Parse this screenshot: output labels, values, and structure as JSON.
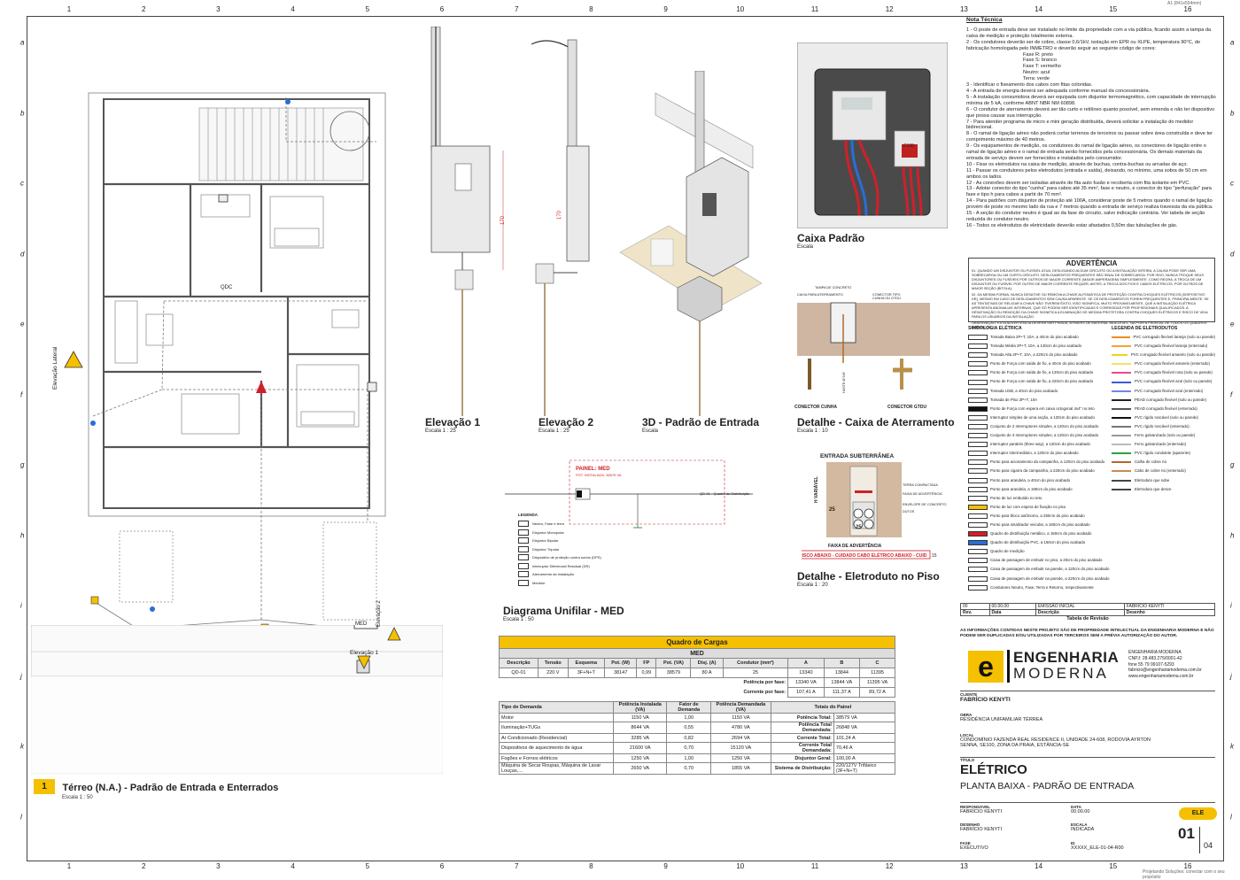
{
  "sheet": {
    "top_code": "A1 (841x594mm)",
    "bottom_note": "Projetando Soluções: conectar com o seu propósito",
    "ruler_numbers": [
      "1",
      "2",
      "3",
      "4",
      "5",
      "6",
      "7",
      "8",
      "9",
      "10",
      "11",
      "12",
      "13",
      "14",
      "15",
      "16"
    ],
    "ruler_letters": [
      "a",
      "b",
      "c",
      "d",
      "e",
      "f",
      "g",
      "h",
      "i",
      "j",
      "k",
      "l"
    ]
  },
  "plan": {
    "number": "1",
    "title": "Térreo (N.A.) - Padrão de Entrada e Enterrados",
    "scale": "Escala  1 : 50",
    "elev_lateral": "Elevação Lateral",
    "elev1": "Elevação 1",
    "elev2": "Elevação 2",
    "med_label": "MED",
    "qdc_label": "QDC"
  },
  "views": {
    "elev1_title": "Elevação 1",
    "elev1_scale": "Escala  1 : 25",
    "elev2_title": "Elevação 2",
    "elev2_scale": "Escala  1 : 25",
    "view3d_title": "3D - Padrão de Entrada",
    "view3d_scale": "Escala",
    "caixa_title": "Caixa Padrão",
    "caixa_scale": "Escala",
    "aterr_title": "Detalhe - Caixa de Aterramento",
    "aterr_scale": "Escala  1 : 10",
    "eletroduto_title": "Detalhe - Eletroduto no Piso",
    "eletroduto_scale": "Escala  1 : 20",
    "unifilar_title": "Diagrama Unifilar - MED",
    "unifilar_scale": "Escala  1 : 50",
    "dim_170": "170",
    "entrada_subterranea": "ENTRADA SUBTERRÂNEA",
    "faixa_adv": "FAIXA DE ADVERTÊNCIA",
    "faixa_text": "RISCO ABAIXO - CUIDADO CABO ELÉTRICO ABAIXO - CUID",
    "conector_cunha": "CONECTOR CUNHA",
    "conector_gtdu": "CONECTOR GTDU",
    "tampa": "TAMPA DE CONCRETO",
    "caixa_aterr": "CAIXA PARA ATERRAMENTO",
    "conector_tipo": "CONECTOR TIPO CUNHA OU GTDU",
    "haste": "HASTE Ø 5/8\"",
    "painel_med": "PAINEL: MED",
    "pot_instalada": "POT. INSTALADA: 38579 VA",
    "qd01": "QD-01 - Quadro de Distribuição",
    "legenda": "LEGENDA",
    "leg_items": [
      "Neutro, Fase e terra",
      "Disjuntor Monopolar",
      "Disjuntor Bipolar",
      "Disjuntor Tripolar",
      "Dispositivo de proteção contra surtos (DPS)",
      "Interruptor Diferencial Residual (DR)",
      "Aterramento da Instalação",
      "Medidor"
    ],
    "terra_compactada": "TERRA COMPACTADA",
    "faixa_adv2": "FAIXA DE ADVERTÊNCIA",
    "envelope": "ENVELOPE DE CONCRETO",
    "dutos": "DUTOS",
    "dim_25": "25",
    "dim_var": "H VARIÁVEL",
    "dim_15": "15",
    "meter_label": "C100"
  },
  "notes": {
    "heading": "Nota Técnica",
    "lines": [
      "1 - O poste de entrada deve ser instalado no limite da propriedade com a via pública, ficando assim a tampa da caixa de medição e proteção totalmente externa.",
      "2 - Os condutores deverão ser de cobre, classe  0,6/1kV, isolação em EPR ou XLPE, temperatura 90°C, de fabricação homologada pelo INMETRO e deverão seguir ao seguinte código de cores:",
      "Fase R: preto",
      "Fase S: branco",
      "Fase T: vermelho",
      "Neutro: azul",
      "Terra: verde",
      "3 - Identificar o fiseamento dos cabos com fitas coloridas.",
      "4 - A entrada de energia deverá ser adequada conforme manual da concessionária.",
      "5 - A instalação consumidora deverá ser equipada com disjuntor termomagnético, com capacidade de interrupção mínima de 5 kA, conforme ABNT NBR NM 60898.",
      "6 - O condutor de aterramento deverá ser tão curto e retilíneo quanto possível, sem emenda e não ter dispositivo que possa causar sua interrupção.",
      "7 - Para atender programa de micro e mini geração distribuída, deverá solicitar a instalação do medidor bidirecional.",
      "8 - O ramal de ligação aéreo não poderá cortar terrenos de terceiros ou passar sobre área construída e deve ter comprimento máximo de 40 metros.",
      "9 - Os equipamentos de medição, os condutores do ramal de ligação aéreo, os conectores de ligação entre o ramal de ligação aéreo e o ramal de entrada serão fornecidos pela concessionária. Os demais materiais da entrada de serviço devem ser fornecidos e instalados pelo consumidor.",
      "10 - Fixar os eletrodutos na caixa de medição, através de buchas, contra-buchas ou arruelas de aço.",
      "11 - Passar os condutores pelos eletrodutos (entrada e saída), deixando, no mínimo, uma sobra de 50 cm em ambos os lados.",
      "12 - As conexões devem ser isoladas através de fita auto fusão e recoberta com fita isolante em PVC.",
      "13 - Adotar conector do tipo \"cunha\" para cabos até 35 mm², fase e neutro, e conector do tipo \"perfuração\" para fase e tipo h para cabos a partir de 70 mm².",
      "14 - Para padrões com disjuntor de proteção até 100A, considerar poste de 5 metros quando o ramal de ligação provém de poste no mesmo lado da rua e 7 metros quando a entrada de serviço realiza travessia da via pública.",
      "15 - A seção do condutor neutro é igual ao da fase do circuito, salvo indicação contrária. Ver tabela de seção reduzida do condutor neutro.",
      "16 - Todos os eletrodutos de eletricidade deverão estar afastados 0,50m das tubulações de gás."
    ]
  },
  "advert": {
    "heading": "ADVERTÊNCIA",
    "p1": "01. QUANDO UM DISJUNTOR OU FUSÍVEL ATUA, DESLIGANDO ALGUM CIRCUITO OU A INSTALAÇÃO INTEIRA, A CAUSA PODE SER UMA SOBRECARGA OU UM CURTO-CIRCUITO. DESLIGAMENTOS FREQUENTES SÃO SINAL DE SOBRECARGA. POR ISSO, NUNCA TROQUE SEUS DISJUNTORES OU FUSÍVEIS POR OUTROS DE MAIOR CORRENTE (MAIOR AMPERAGEM) SIMPLESMENTE. COMO REGRA, A TROCA DE UM DISJUNTOR OU FUSÍVEL POR OUTRO DE MAIOR CORRENTE REQUER, ANTES, A TROCA DOS FIOS E CABOS ELÉTRICOS, POR OUTROS DE MAIOR SEÇÃO (BITOLA).",
    "p2": "02. DA MESMA FORMA, NUNCA DESATIVE OU REMOVA A CHAVE AUTOMÁTICA DE PROTEÇÃO CONTRA CHOQUES ELÉTRICOS (DISPOSITIVO DR), MESMO EM CASO DE DESLIGAMENTOS SEM CAUSA APARENTE. SE OS DESLIGAMENTOS FOREM FREQUENTES E, PRINCIPALMENTE, SE AS TENTATIVAS DE RELIGAR A CHAVE NÃO TIVEREM ÊXITO, ISSO SIGNIFICA, MUITO PROVAVELMENTE, QUE A INSTALAÇÃO ELÉTRICA APRESENTA ANOMALIAS INTERNAS, QUE SÓ PODEM SER IDENTIFICADAS E CORRIGIDAS POR PROFISSIONAIS QUALIFICADOS. A DESATIVAÇÃO OU REMOÇÃO DA CHAVE SIGNIFICA A ELIMINAÇÃO DE MEDIDA PROTETORA CONTRA CHOQUES ELÉTRICOS E RISCO DE VIDA PARA OS USUÁRIOS DA INSTALAÇÃO.",
    "obs": "OBSERVAÇÃO: ESTA ADVERTÊNCIA DEVERÁ SER FIXADA, ATRAVÉS DE MATERIAL INDELÉVEL, NA PORTA FRONTAL DE TODOS OS QUADROS ELÉTRICOS."
  },
  "legend": {
    "simb_heading": "SIMBOLOGIA ELÉTRICA",
    "eletr_heading": "LEGENDA DE ELETRODUTOS",
    "simb": [
      "Tomada Baixa 2P+T, 10A, a 40cm do piso acabado",
      "Tomada Média 2P+T, 10A, a 130cm do piso acabado",
      "Tomada Alta 2P+T, 10A, a 220cm do piso acabado",
      "Ponto de Força com saída de fio, a 40cm do piso acabado",
      "Ponto de Força com saída de fio, a 120cm do piso acabado",
      "Ponto de Força com saída de fio, a 220cm do piso acabado",
      "Tomada USB, a 40cm do piso acabado",
      "Tomada de Piso 2P+T, 10A",
      "Ponto de Força com espera em caixa octogonal 4x4\" no teto",
      "Interruptor simples de uma seção, a 120cm do piso acabado",
      "Conjunto de 2 Interruptores simples, a 120cm do piso acabado",
      "Conjunto de 3 Interruptores simples, a 120cm do piso acabado",
      "Interruptor paralelo (three way), a 120cm do piso acabado",
      "Interruptor intermediário, a 120cm do piso acabado",
      "Ponto para acionamento da campainha, a 120cm do piso acabado",
      "Ponto para cigarra da campainha, a 220cm do piso acabado",
      "Ponto para arandela, a 40cm do piso acabado",
      "Ponto para arandela, a 180cm do piso acabado",
      "Ponto de luz embutido no teto",
      "Ponto de luz com espera de fixação no piso",
      "Ponto para bloco autônomo, a 250cm do piso acabado",
      "Ponto para sinalizador veicular, a 160cm do piso acabado",
      "Quadro de distribuição metálico, a 150cm do piso acabado",
      "Quadro de distribuição PVC, a 150cm do piso acabado",
      "Quadro de medição",
      "Caixa de passagem de embutir no piso, a 40cm do piso acabado",
      "Caixa de passagem de embutir na parede, a 120cm do piso acabado",
      "Caixa de passagem de embutir na parede, a 220cm do piso acabado",
      "Condutores Neutro, Fase, Terra e Retorno, respectivamente"
    ],
    "eletr": [
      {
        "label": "PVC corrugado flexível laranja (solo ou parede)",
        "color": "#f08a1c"
      },
      {
        "label": "PVC corrugado flexível laranja (enterrado)",
        "color": "#f5a33a"
      },
      {
        "label": "PVC corrugado flexível amarelo (solo ou parede)",
        "color": "#f2d21c"
      },
      {
        "label": "PVC corrugado flexível amarelo (enterrado)",
        "color": "#f6e06a"
      },
      {
        "label": "PVC corrugado flexível rosa (solo ou parede)",
        "color": "#e94b8a"
      },
      {
        "label": "PVC corrugado flexível azul (solo ou parede)",
        "color": "#3a5ad8"
      },
      {
        "label": "PVC corrugado flexível azul (enterrado)",
        "color": "#6f88e6"
      },
      {
        "label": "PEAD corrugado flexível (solo ou parede)",
        "color": "#222222"
      },
      {
        "label": "PEAD corrugado flexível (enterrado)",
        "color": "#555555"
      },
      {
        "label": "PVC rígido roscável (solo ou parede)",
        "color": "#111111"
      },
      {
        "label": "PVC rígido roscável (enterrado)",
        "color": "#777777"
      },
      {
        "label": "Ferro galvanizado (solo ou parede)",
        "color": "#999999"
      },
      {
        "label": "Ferro galvanizado (enterrado)",
        "color": "#bbbbbb"
      },
      {
        "label": "PVC rígido condulete (aparente)",
        "color": "#2f9e44"
      },
      {
        "label": "Calha de cobre nú",
        "color": "#b06a2e"
      },
      {
        "label": "Cabo de cobre nú (enterrado)",
        "color": "#c98a50"
      },
      {
        "label": "Eletroduto que sobe",
        "color": "#444444"
      },
      {
        "label": "Eletroduto que desce",
        "color": "#444444"
      }
    ]
  },
  "revision": {
    "row": [
      "00",
      "00.00.00",
      "EMISSÃO INICIAL",
      "FABRÍCIO KENYTI"
    ],
    "head": [
      "Rev.",
      "Data",
      "Descrição",
      "Desenho"
    ],
    "title": "Tabela de Revisão"
  },
  "titleblock": {
    "disclaimer": "AS INFORMAÇÕES CONTIDAS NESTE PROJETO SÃO DE PROPRIEDADE INTELECTUAL DA ENGENHARIA MODERNA E NÃO PODEM SER DUPLICADAS E/OU UTILIZADAS POR TERCEIROS SEM A PRÉVIA AUTORIZAÇÃO DO AUTOR.",
    "logo_line1": "ENGENHARIA",
    "logo_line2": "MODERNA",
    "company": "ENGENHARIA MODERNA",
    "cnpj": "CNPJ: 28.483.275/0001-42",
    "fone": "fone 55 79 99107-5293",
    "email": "fabricio@engenhariamoderna.com.br",
    "site": "www.engenhariamoderna.com.br",
    "cliente_label": "CLIENTE",
    "cliente": "FABRÍCIO KENYTI",
    "obra_label": "OBRA",
    "obra": "RESIDÊNCIA UNIFAMILIAR TÉRREA",
    "local_label": "LOCAL",
    "local": "CONDOMÍNIO FAZENDA REAL RESIDENCE II, UNIDADE 24-608, RODOVIA AYRTON SENNA, SE100, ZONA DA PRAIA, ESTÂNCIA-SE",
    "titulo_label": "TÍTULO",
    "titulo": "ELÉTRICO",
    "subtitulo": "PLANTA BAIXA - PADRÃO DE ENTRADA",
    "badge": "ELE",
    "resp_label": "RESPONSÁVEL",
    "resp": "FABRÍCIO KENYTI",
    "data_label": "DATA",
    "data": "00.00.00",
    "des_label": "DESENHO",
    "des": "FABRÍCIO KENYTI",
    "esc_label": "ESCALA",
    "esc": "INDICADA",
    "fase_label": "FASE",
    "fase": "EXECUTIVO",
    "id_label": "ID",
    "id": "XXXXX_ELE-01-04-R00",
    "page": "01",
    "total": "04"
  },
  "quadro": {
    "title": "Quadro de Cargas",
    "sub": "MED",
    "head": [
      "Descrição",
      "Tensão",
      "Esquema",
      "Pot. (W)",
      "FP",
      "Pot. (VA)",
      "Disj. (A)",
      "Condutor (mm²)",
      "A",
      "B",
      "C"
    ],
    "row": [
      "QD-01",
      "220 V",
      "3F+N+T",
      "38147",
      "0,99",
      "38579",
      "80 A",
      "25",
      "13340",
      "13844",
      "11395"
    ],
    "pot_fase_label": "Potência por fase:",
    "pot_fase": [
      "13340 VA",
      "13844 VA",
      "11395 VA"
    ],
    "corr_fase_label": "Corrente por fase:",
    "corr_fase": [
      "107,41 A",
      "111,37 A",
      "89,72 A"
    ]
  },
  "demanda": {
    "head": [
      "Tipo de Demanda",
      "Potência Instalada (VA)",
      "Fator de Demanda",
      "Potência Demandada (VA)",
      "Totais do Painel"
    ],
    "rows": [
      [
        "Motor",
        "1150 VA",
        "1,00",
        "1150 VA",
        "Potência Total:",
        "38579 VA"
      ],
      [
        "Iluminação+TUGs",
        "8644 VA",
        "0,55",
        "4780 VA",
        "Potência Total Demandada:",
        "26848 VA"
      ],
      [
        "Ar Condicionado (Residencial)",
        "3285 VA",
        "0,82",
        "2694 VA",
        "Corrente Total:",
        "101,24 A"
      ],
      [
        "Dispositivos de aquecimento de água",
        "21600 VA",
        "0,70",
        "15120 VA",
        "Corrente Total Demandada:",
        "70,46 A"
      ],
      [
        "Fogões e Fornos elétricos",
        "1250 VA",
        "1,00",
        "1250 VA",
        "Disjuntor Geral:",
        "100,00 A"
      ],
      [
        "Máquina de Secar Roupas, Máquina de Lavar Louças,...",
        "2650 VA",
        "0,70",
        "1855 VA",
        "Sistema de Distribuição:",
        "220/127V Trifásico (3F+N+T)"
      ]
    ]
  },
  "colors": {
    "accent": "#f5c000",
    "wire_red": "#d0202a",
    "wire_blue": "#2a6dd8",
    "warn_red": "#d0202a"
  }
}
